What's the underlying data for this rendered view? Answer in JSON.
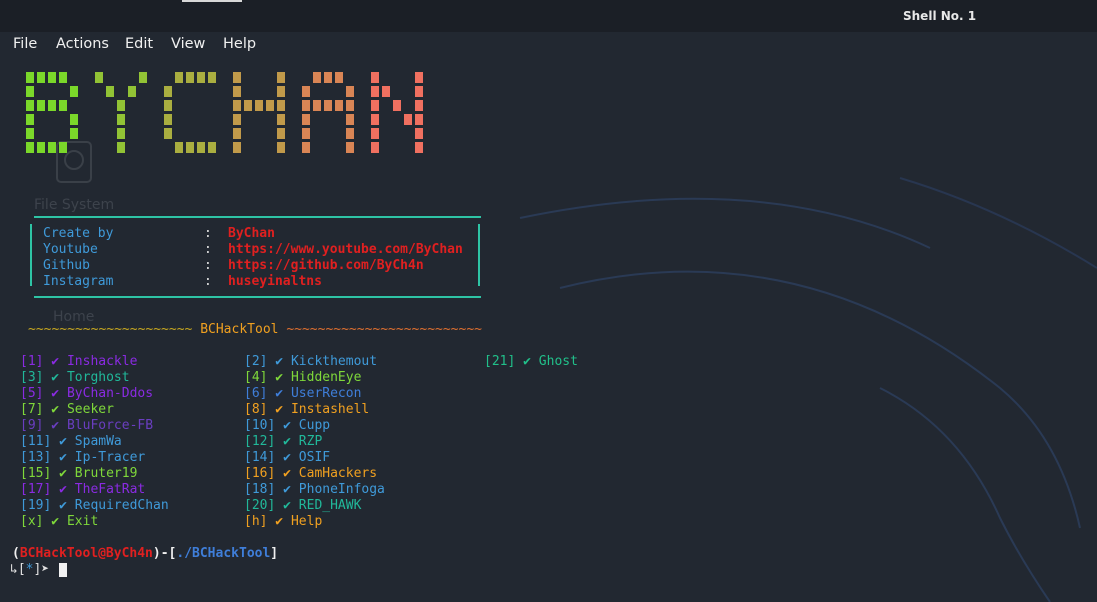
{
  "window": {
    "title": "Shell No. 1"
  },
  "menu": {
    "items": [
      "File",
      "Actions",
      "Edit",
      "View",
      "Help"
    ]
  },
  "desktop_labels": {
    "file_system": "File System",
    "home": "Home"
  },
  "banner": {
    "text": "BYCHAN"
  },
  "info": [
    {
      "label": "Create by",
      "value": "ByChan"
    },
    {
      "label": "Youtube",
      "value": "https://www.youtube.com/ByChan"
    },
    {
      "label": "Github",
      "value": "https://github.com/ByCh4n"
    },
    {
      "label": "Instagram",
      "value": "huseyinaltns"
    }
  ],
  "divider": {
    "left": "~~~~~~~~~~~~~~~~~~~~~",
    "title": "BCHackTool",
    "right": "~~~~~~~~~~~~~~~~~~~~~~~~~"
  },
  "options": [
    {
      "key": "[1]",
      "name": "Inshackle",
      "color": "#8a2be2"
    },
    {
      "key": "[2]",
      "name": "Kickthemout",
      "color": "#3f9ad9"
    },
    {
      "key": "[21]",
      "name": "Ghost",
      "color": "#21c08a"
    },
    {
      "key": "[3]",
      "name": "Torghost",
      "color": "#21b89a"
    },
    {
      "key": "[4]",
      "name": "HiddenEye",
      "color": "#7fd83a"
    },
    {
      "key": "[5]",
      "name": "ByChan-Ddos",
      "color": "#8a2be2"
    },
    {
      "key": "[6]",
      "name": "UserRecon",
      "color": "#3f7ed9"
    },
    {
      "key": "[7]",
      "name": "Seeker",
      "color": "#7fd83a"
    },
    {
      "key": "[8]",
      "name": "Instashell",
      "color": "#f0a020"
    },
    {
      "key": "[9]",
      "name": "BluForce-FB",
      "color": "#6a3ec0"
    },
    {
      "key": "[10]",
      "name": "Cupp",
      "color": "#3f9ad9"
    },
    {
      "key": "[11]",
      "name": "SpamWa",
      "color": "#3f9ad9"
    },
    {
      "key": "[12]",
      "name": "RZP",
      "color": "#21b89a"
    },
    {
      "key": "[13]",
      "name": "Ip-Tracer",
      "color": "#3f9ad9"
    },
    {
      "key": "[14]",
      "name": "OSIF",
      "color": "#3f9ad9"
    },
    {
      "key": "[15]",
      "name": "Bruter19",
      "color": "#7fd83a"
    },
    {
      "key": "[16]",
      "name": "CamHackers",
      "color": "#f0a020"
    },
    {
      "key": "[17]",
      "name": "TheFatRat",
      "color": "#8a2be2"
    },
    {
      "key": "[18]",
      "name": "PhoneInfoga",
      "color": "#3f9ad9"
    },
    {
      "key": "[19]",
      "name": "RequiredChan",
      "color": "#3f9ad9"
    },
    {
      "key": "[20]",
      "name": "RED_HAWK",
      "color": "#21b89a"
    },
    {
      "key": "[x]",
      "name": "Exit",
      "color": "#7fd83a"
    },
    {
      "key": "[h]",
      "name": "Help",
      "color": "#f0a020"
    }
  ],
  "prompt": {
    "user": "BCHackTool@ByCh4n",
    "path": "./BCHackTool",
    "line2_prefix": "↳[",
    "star": "*",
    "line2_suffix": "]➤"
  },
  "colors": {
    "accent": "#2ec4a5",
    "value": "#e02020",
    "banner_start": "#7bd82a",
    "banner_end": "#f07060"
  }
}
